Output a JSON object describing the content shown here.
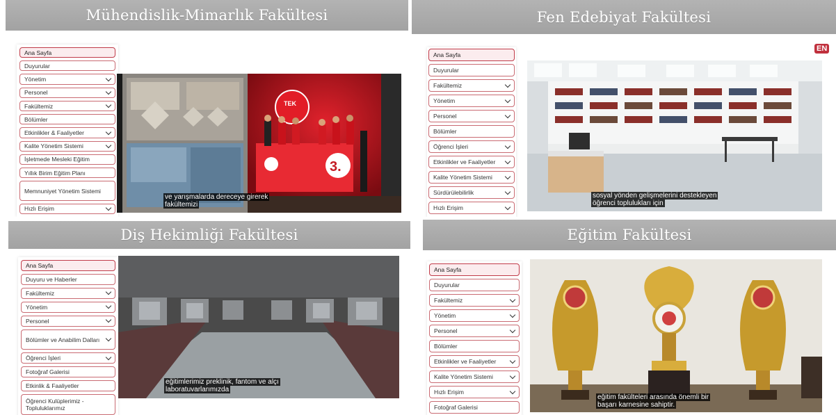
{
  "panels": [
    {
      "title": "Mühendislik-Mimarlık Fakültesi",
      "menu": [
        {
          "label": "Ana Sayfa",
          "active": true,
          "chevron": false
        },
        {
          "label": "Duyurular",
          "chevron": false
        },
        {
          "label": "Yönetim",
          "chevron": true
        },
        {
          "label": "Personel",
          "chevron": true
        },
        {
          "label": "Fakültemiz",
          "chevron": true
        },
        {
          "label": "Bölümler",
          "chevron": false
        },
        {
          "label": "Etkinlikler & Faaliyetler",
          "chevron": true
        },
        {
          "label": "Kalite Yönetim Sistemi",
          "chevron": true
        },
        {
          "label": "İşletmede Mesleki Eğitim",
          "chevron": false
        },
        {
          "label": "Yıllık Birim Eğitim Planı",
          "chevron": false
        },
        {
          "label": "Memnuniyet Yönetim Sistemi",
          "chevron": false
        },
        {
          "label": "Hızlı Erişim",
          "chevron": true
        }
      ],
      "subtitle": [
        "ve yarışmalarda dereceye girerek",
        "fakültemizi"
      ],
      "video_scene": "team-with-banner"
    },
    {
      "title": "Fen Edebiyat Fakültesi",
      "language_badge": "EN",
      "menu": [
        {
          "label": "Ana Sayfa",
          "active": true,
          "chevron": false
        },
        {
          "label": "Duyurular",
          "chevron": false
        },
        {
          "label": "Fakültemiz",
          "chevron": true
        },
        {
          "label": "Yönetim",
          "chevron": true
        },
        {
          "label": "Personel",
          "chevron": true
        },
        {
          "label": "Bölümler",
          "chevron": false
        },
        {
          "label": "Öğrenci İşleri",
          "chevron": true
        },
        {
          "label": "Etkinlikler ve Faaliyetler",
          "chevron": true
        },
        {
          "label": "Kalite Yönetim Sistemi",
          "chevron": true
        },
        {
          "label": "Sürdürülebilirlik",
          "chevron": true
        },
        {
          "label": "Hızlı Erişim",
          "chevron": true
        }
      ],
      "subtitle": [
        "sosyal yönden gelişmelerini destekleyen",
        "öğrenci toplulukları için"
      ],
      "video_scene": "library"
    },
    {
      "title": "Diş Hekimliği Fakültesi",
      "menu": [
        {
          "label": "Ana Sayfa",
          "active": true,
          "chevron": false
        },
        {
          "label": "Duyuru ve Haberler",
          "chevron": false
        },
        {
          "label": "Fakültemiz",
          "chevron": true
        },
        {
          "label": "Yönetim",
          "chevron": true
        },
        {
          "label": "Personel",
          "chevron": true
        },
        {
          "label": "Bölümler ve Anabilim Dalları",
          "chevron": true
        },
        {
          "label": "Öğrenci İşleri",
          "chevron": true
        },
        {
          "label": "Fotoğraf Galerisi",
          "chevron": false
        },
        {
          "label": "Etkinlik & Faaliyetler",
          "chevron": false
        },
        {
          "label": "Öğrenci Kulüplerimiz - Topluluklarımız",
          "chevron": false
        }
      ],
      "subtitle": [
        "eğitimlerimiz preklinik, fantom ve alçı",
        "laboratuvarlarımızda"
      ],
      "video_scene": "dental-lab"
    },
    {
      "title": "Eğitim Fakültesi",
      "menu": [
        {
          "label": "Ana Sayfa",
          "active": true,
          "chevron": false
        },
        {
          "label": "Duyurular",
          "chevron": false
        },
        {
          "label": "Fakültemiz",
          "chevron": true
        },
        {
          "label": "Yönetim",
          "chevron": true
        },
        {
          "label": "Personel",
          "chevron": true
        },
        {
          "label": "Bölümler",
          "chevron": false
        },
        {
          "label": "Etkinlikler ve Faaliyetler",
          "chevron": true
        },
        {
          "label": "Kalite Yönetim Sistemi",
          "chevron": true
        },
        {
          "label": "Hızlı Erişim",
          "chevron": true
        },
        {
          "label": "Fotoğraf Galerisi",
          "chevron": false
        }
      ],
      "subtitle": [
        "eğitim fakülteleri arasında önemli bir",
        "başarı karnesine sahiptir."
      ],
      "video_scene": "trophies"
    }
  ]
}
